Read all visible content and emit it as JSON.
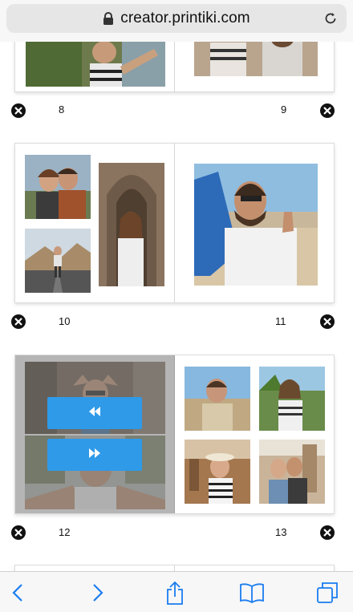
{
  "browser": {
    "url": "creator.printiki.com",
    "icons": {
      "lock": "lock-icon",
      "reload": "reload-icon"
    }
  },
  "spreads": [
    {
      "left_page": "8",
      "right_page": "9"
    },
    {
      "left_page": "10",
      "right_page": "11"
    },
    {
      "left_page": "12",
      "right_page": "13",
      "selected": true
    }
  ],
  "toolbar": {
    "icons": [
      "back-icon",
      "forward-icon",
      "share-icon",
      "bookmarks-icon",
      "tabs-icon"
    ]
  },
  "colors": {
    "accent": "#2f9ae8",
    "toolbar_icon": "#1a7cf0"
  }
}
